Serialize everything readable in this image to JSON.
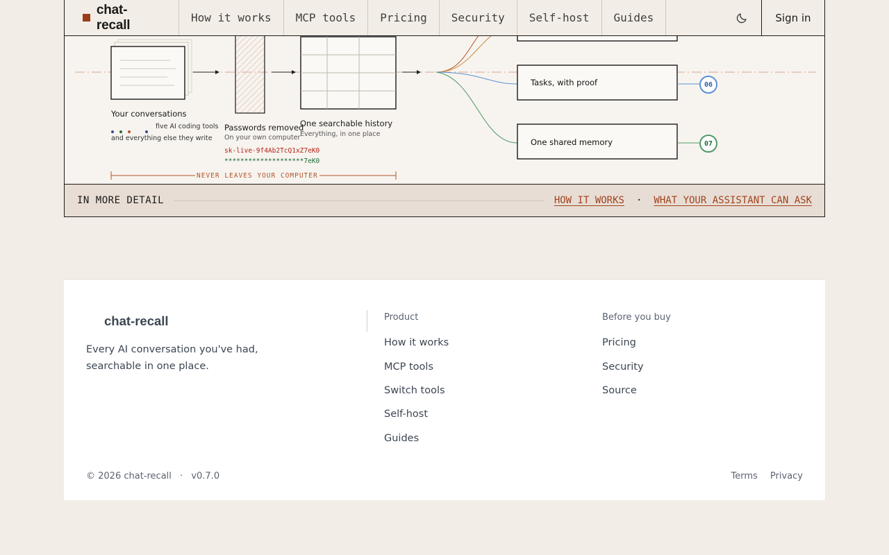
{
  "header": {
    "brand": "chat-recall",
    "nav": [
      {
        "label": "How it works"
      },
      {
        "label": "MCP tools"
      },
      {
        "label": "Pricing"
      },
      {
        "label": "Security"
      },
      {
        "label": "Self-host"
      },
      {
        "label": "Guides"
      }
    ],
    "theme_icon": "moon-icon",
    "sign_in": "Sign in"
  },
  "diagram": {
    "stage_conversations": {
      "title": "Your conversations",
      "line1": "five AI coding tools",
      "line2": "and everything else they write",
      "dot_colors": [
        "#3b4a8f",
        "#1f6b36",
        "#b5532a",
        "#3b4a8f"
      ]
    },
    "stage_passwords": {
      "title": "Passwords removed",
      "subtitle": "On your own computer",
      "secret_raw": "sk-live-9f4Ab2TcQ1xZ7eK0",
      "secret_masked": "********************7eK0"
    },
    "stage_history": {
      "title": "One searchable history",
      "subtitle": "Everything, in one place"
    },
    "never_leaves": "NEVER LEAVES YOUR COMPUTER",
    "outputs": [
      {
        "label": "Tasks, with proof",
        "badge": "06",
        "color": "#5b8fd6"
      },
      {
        "label": "One shared memory",
        "badge": "07",
        "color": "#4f9a68"
      }
    ]
  },
  "detail": {
    "label": "IN MORE DETAIL",
    "links": [
      {
        "label": "HOW IT WORKS"
      },
      {
        "label": "WHAT YOUR ASSISTANT CAN ASK"
      }
    ],
    "separator": "·"
  },
  "footer": {
    "brand": "chat-recall",
    "tagline": "Every AI conversation you've had, searchable in one place.",
    "product": {
      "heading": "Product",
      "links": [
        "How it works",
        "MCP tools",
        "Switch tools",
        "Self-host",
        "Guides"
      ]
    },
    "before_you_buy": {
      "heading": "Before you buy",
      "links": [
        "Pricing",
        "Security",
        "Source"
      ]
    },
    "copyright": "© 2026 chat-recall",
    "dot": "·",
    "version": "v0.7.0",
    "legal": [
      "Terms",
      "Privacy"
    ]
  },
  "colors": {
    "accent": "#9a3d18",
    "link": "#a0441e",
    "background": "#f2eee7",
    "detail_bar": "#e8ddd4"
  }
}
